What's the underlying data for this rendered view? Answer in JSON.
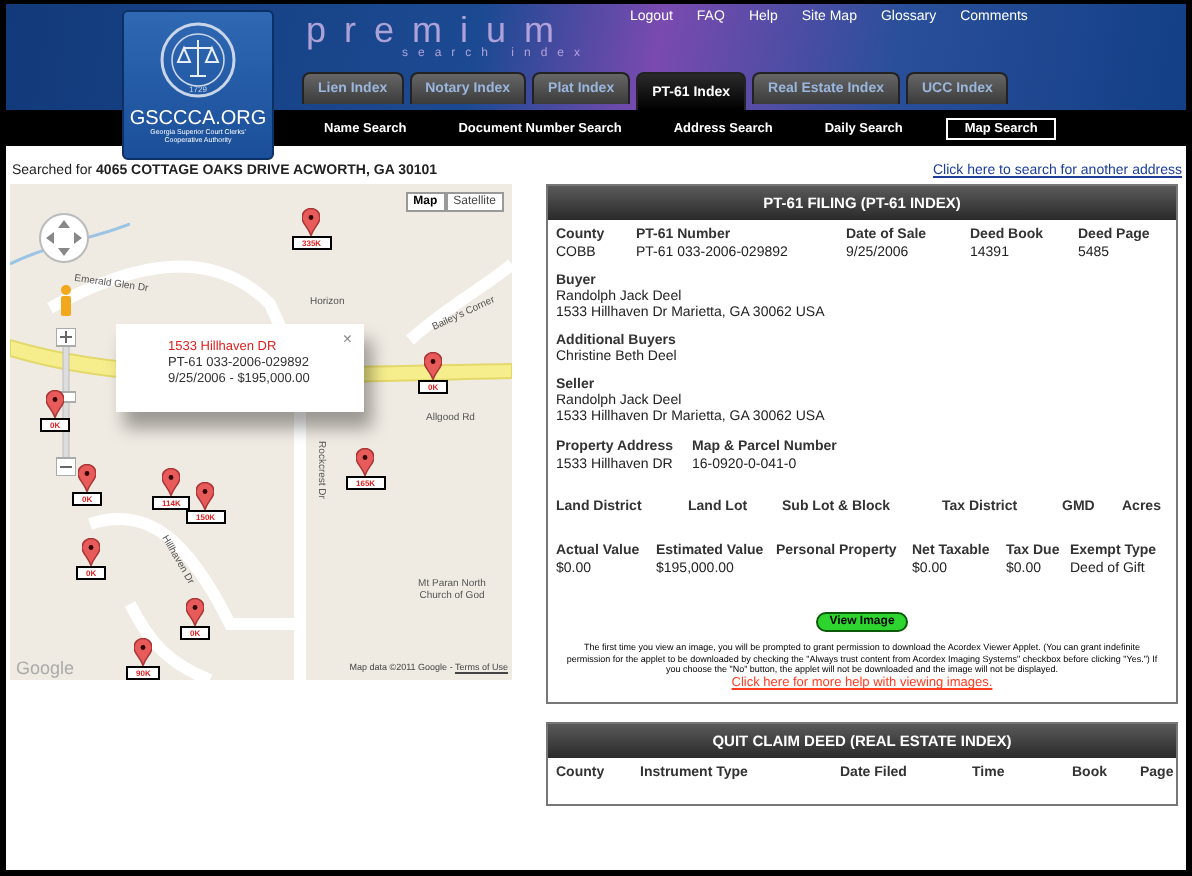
{
  "header": {
    "logo": {
      "title": "GSCCCA.ORG",
      "subtitle": "Georgia Superior Court Clerks' Cooperative Authority",
      "year": "1729"
    },
    "brand": {
      "title": "premium",
      "subtitle": "search index"
    },
    "top_links": [
      "Logout",
      "FAQ",
      "Help",
      "Site Map",
      "Glossary",
      "Comments"
    ],
    "tabs": [
      {
        "label": "Lien Index",
        "selected": false
      },
      {
        "label": "Notary Index",
        "selected": false
      },
      {
        "label": "Plat Index",
        "selected": false
      },
      {
        "label": "PT-61 Index",
        "selected": true
      },
      {
        "label": "Real Estate Index",
        "selected": false
      },
      {
        "label": "UCC Index",
        "selected": false
      }
    ],
    "subtabs": [
      {
        "label": "Name Search",
        "selected": false
      },
      {
        "label": "Document Number Search",
        "selected": false
      },
      {
        "label": "Address Search",
        "selected": false
      },
      {
        "label": "Daily Search",
        "selected": false
      },
      {
        "label": "Map Search",
        "selected": true
      }
    ]
  },
  "search_bar": {
    "prefix": "Searched for",
    "address": "4065 COTTAGE OAKS DRIVE ACWORTH, GA 30101",
    "link": "Click here to search for another address"
  },
  "map": {
    "type_buttons": [
      {
        "label": "Map",
        "selected": true
      },
      {
        "label": "Satellite",
        "selected": false
      }
    ],
    "road_labels": [
      "Emerald Glen Dr",
      "Horizon",
      "Bailey's Corner",
      "Allgood Rd",
      "Rockcrest Dr",
      "Hillhaven Dr",
      "Mt Paran North Church of God"
    ],
    "pins": [
      {
        "label": "335K"
      },
      {
        "label": "0K"
      },
      {
        "label": "0K"
      },
      {
        "label": "0K"
      },
      {
        "label": "114K"
      },
      {
        "label": "150K"
      },
      {
        "label": "165K"
      },
      {
        "label": "0K"
      },
      {
        "label": "0K"
      },
      {
        "label": "90K"
      }
    ],
    "popup": {
      "title": "1533 Hillhaven DR",
      "line_1": "PT-61 033-2006-029892",
      "line_2": "9/25/2006 - $195,000.00",
      "close": "×"
    },
    "logo": "Google",
    "attribution": "Map data ©2011 Google -",
    "terms": "Terms of Use"
  },
  "filing": {
    "title": "PT-61 FILING (PT-61 INDEX)",
    "top_row": [
      {
        "label": "County",
        "value": "COBB"
      },
      {
        "label": "PT-61 Number",
        "value": "PT-61 033-2006-029892"
      },
      {
        "label": "Date of Sale",
        "value": "9/25/2006"
      },
      {
        "label": "Deed Book",
        "value": "14391"
      },
      {
        "label": "Deed Page",
        "value": "5485"
      }
    ],
    "parties": [
      {
        "label": "Buyer",
        "lines": [
          "Randolph Jack Deel",
          "1533 Hillhaven Dr Marietta, GA 30062 USA"
        ]
      },
      {
        "label": "Additional Buyers",
        "lines": [
          "Christine Beth Deel"
        ]
      },
      {
        "label": "Seller",
        "lines": [
          "Randolph Jack Deel",
          "1533 Hillhaven Dr Marietta, GA 30062 USA"
        ]
      }
    ],
    "property_row": [
      {
        "label": "Property Address",
        "value": "1533 Hillhaven DR"
      },
      {
        "label": "Map & Parcel Number",
        "value": "16-0920-0-041-0"
      }
    ],
    "land_row": [
      "Land District",
      "Land Lot",
      "Sub Lot & Block",
      "Tax District",
      "GMD",
      "Acres"
    ],
    "value_row": [
      {
        "label": "Actual Value",
        "value": "$0.00"
      },
      {
        "label": "Estimated Value",
        "value": "$195,000.00"
      },
      {
        "label": "Personal Property"
      },
      {
        "label": "Net Taxable",
        "value": "$0.00"
      },
      {
        "label": "Tax Due",
        "value": "$0.00"
      },
      {
        "label": "Exempt Type",
        "value": "Deed of Gift"
      }
    ],
    "view_button": "View Image",
    "notice": "The first time you view an image, you will be prompted to grant permission to download the Acordex Viewer Applet. (You can grant indefinite permission for the applet to be downloaded by checking the \"Always trust content from Acordex Imaging Systems\" checkbox before clicking \"Yes.\") If you choose the \"No\" button, the applet will not be downloaded and the image will not be displayed.",
    "help_link": "Click here for more help with viewing images."
  },
  "second": {
    "title": "QUIT CLAIM DEED (REAL ESTATE INDEX)",
    "columns": [
      "County",
      "Instrument Type",
      "Date Filed",
      "Time",
      "Book",
      "Page"
    ]
  }
}
